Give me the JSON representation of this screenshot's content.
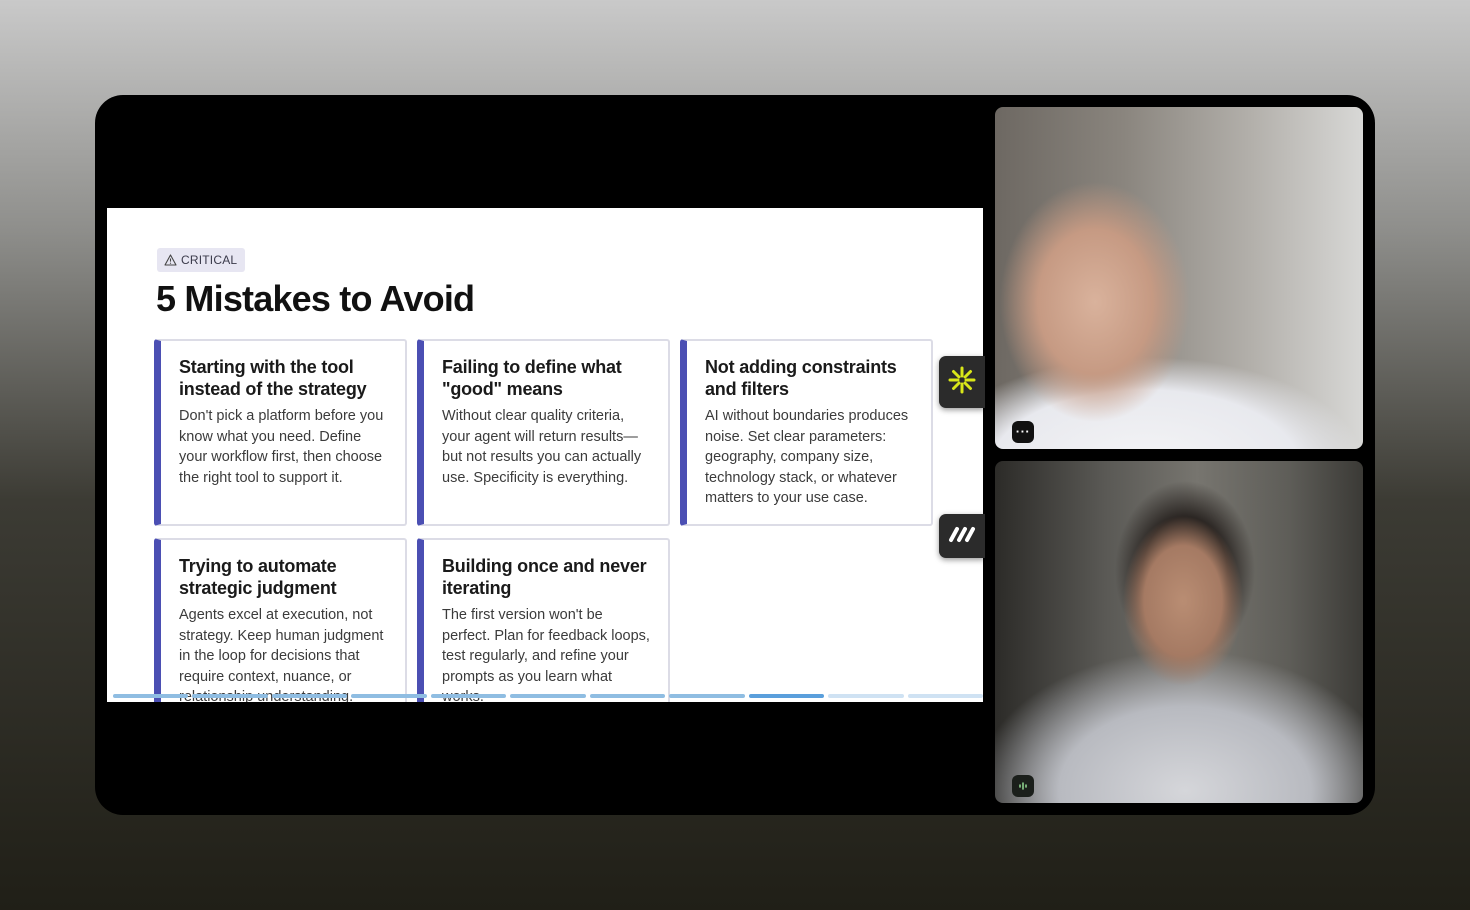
{
  "slide": {
    "tag": {
      "icon": "warning-icon",
      "label": "CRITICAL"
    },
    "title": "5 Mistakes to Avoid",
    "cards": [
      {
        "title": "Starting with the tool instead of the strategy",
        "body": "Don't pick a platform before you know what you need. Define your workflow first, then choose the right tool to support it."
      },
      {
        "title": "Failing to define what \"good\" means",
        "body": "Without clear quality criteria, your agent will return results—but not results you can actually use. Specificity is everything."
      },
      {
        "title": "Not adding constraints and filters",
        "body": "AI without boundaries produces noise. Set clear parameters: geography, company size, technology stack, or whatever matters to your use case."
      },
      {
        "title": "Trying to automate strategic judgment",
        "body": "Agents excel at execution, not strategy. Keep human judgment in the loop for decisions that require context, nuance, or relationship understanding."
      },
      {
        "title": "Building once and never iterating",
        "body": "The first version won't be perfect. Plan for feedback loops, test regularly, and refine your prompts as you learn what works."
      }
    ],
    "accent_color": "#4b4fb3",
    "progress": {
      "segments": 11,
      "current": 9
    }
  },
  "side_buttons": [
    {
      "icon": "asterisk-logo-icon",
      "color": "#d8e619"
    },
    {
      "icon": "m-logo-icon",
      "color": "#ffffff"
    }
  ],
  "participants": [
    {
      "badge": "more-options-icon"
    },
    {
      "badge": "audio-level-icon"
    }
  ]
}
